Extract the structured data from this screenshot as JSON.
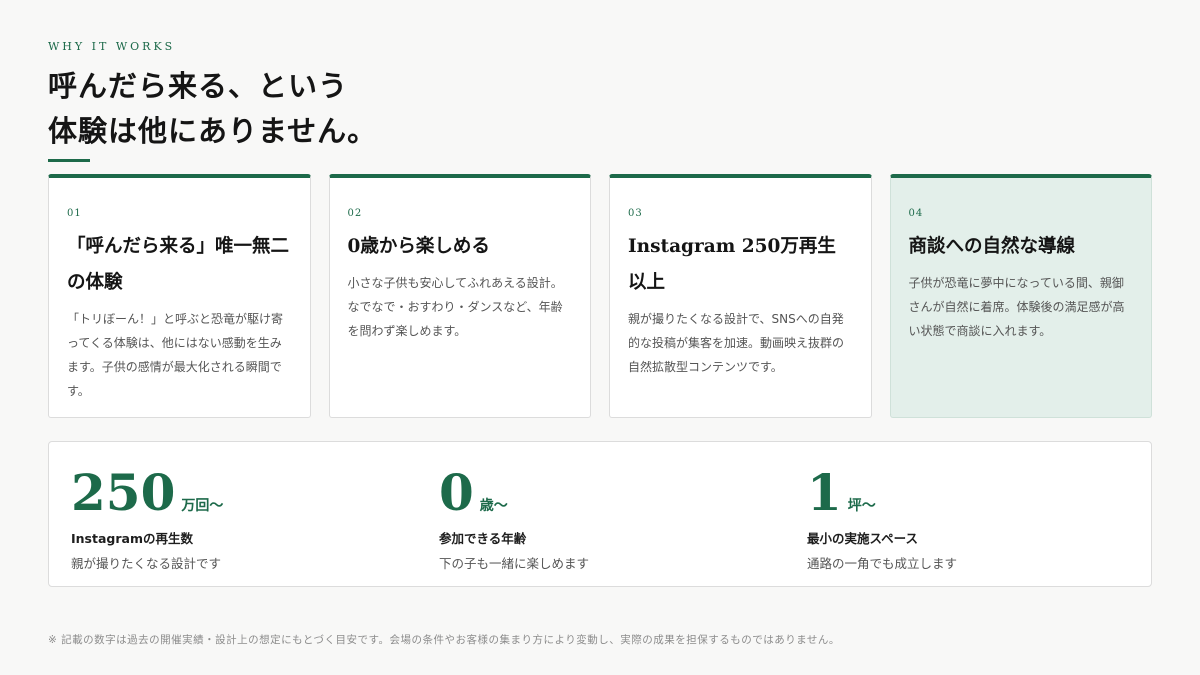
{
  "header": {
    "eyebrow": "WHY IT WORKS",
    "title_line1": "呼んだら来る、という",
    "title_line2": "体験は他にありません。"
  },
  "cards": [
    {
      "num": "01",
      "title": "「呼んだら来る」唯一無二の体験",
      "text": "「トリぼーん！」と呼ぶと恐竜が駆け寄ってくる体験は、他にはない感動を生みます。子供の感情が最大化される瞬間です。",
      "highlighted": false
    },
    {
      "num": "02",
      "title": "0歳から楽しめる",
      "text": "小さな子供も安心してふれあえる設計。なでなで・おすわり・ダンスなど、年齢を問わず楽しめます。",
      "highlighted": false
    },
    {
      "num": "03",
      "title": "Instagram 250万再生以上",
      "text": "親が撮りたくなる設計で、SNSへの自発的な投稿が集客を加速。動画映え抜群の自然拡散型コンテンツです。",
      "highlighted": false
    },
    {
      "num": "04",
      "title": "商談への自然な導線",
      "text": "子供が恐竜に夢中になっている間、親御さんが自然に着席。体験後の満足感が高い状態で商談に入れます。",
      "highlighted": true
    }
  ],
  "stats": [
    {
      "value": "250",
      "unit": "万回〜",
      "label": "Instagramの再生数",
      "desc": "親が撮りたくなる設計です"
    },
    {
      "value": "0",
      "unit": "歳〜",
      "label": "参加できる年齢",
      "desc": "下の子も一緒に楽しめます"
    },
    {
      "value": "1",
      "unit": "坪〜",
      "label": "最小の実施スペース",
      "desc": "通路の一角でも成立します"
    }
  ],
  "footnote": "※ 記載の数字は過去の開催実績・設計上の想定にもとづく目安です。会場の条件やお客様の集まり方により変動し、実際の成果を担保するものではありません。",
  "colors": {
    "accent": "#1d6a4a",
    "highlight_card_bg": "#e3efea",
    "page_bg": "#f8f8f7"
  }
}
